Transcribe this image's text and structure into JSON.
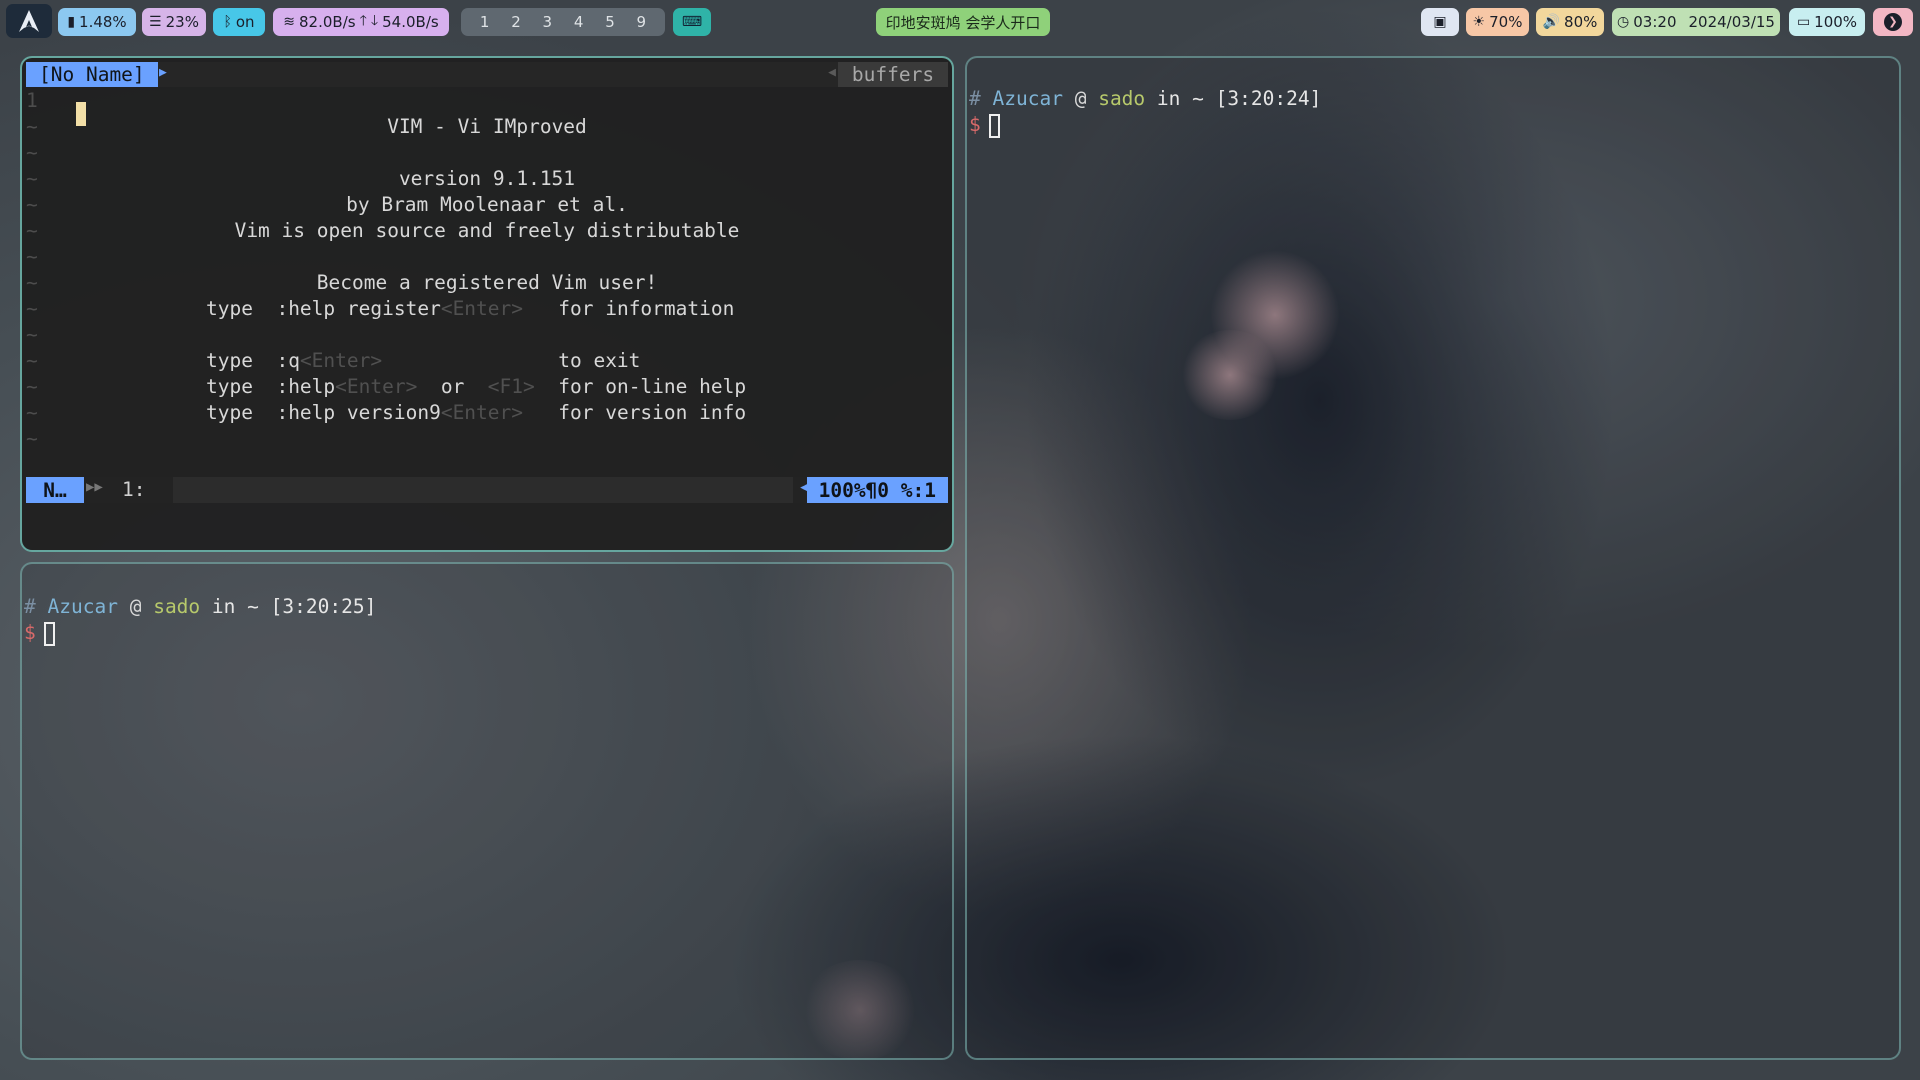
{
  "bar": {
    "cpu": "1.48%",
    "mem": "23%",
    "bluetooth": "on",
    "network": "82.0B/s",
    "network_down": "54.0B/s",
    "workspaces": [
      "1",
      "2",
      "3",
      "4",
      "5",
      "9"
    ],
    "window_title": "印地安斑鸠 会学人开口",
    "brightness": "70%",
    "volume": "80%",
    "clock": "03:20",
    "date": "2024/03/15",
    "battery": "100%",
    "colors": {
      "cpu": "#8cc8f0",
      "mem": "#d6b4e8",
      "bluetooth": "#47c7e8",
      "network": "#d7b0ee",
      "keyboard": "#2fb3a8",
      "title": "#8fd17a",
      "wallpaper": "#dfe6f2",
      "brightness": "#f7c7a6",
      "volume": "#f2d79c",
      "clock": "#bfe0b4",
      "battery": "#c8eef0",
      "power": "#f3b7c4"
    }
  },
  "vim": {
    "tab_name": "[No Name]",
    "buffers_label": "buffers",
    "gutter": [
      "1",
      "~",
      "~",
      "~",
      "~",
      "~",
      "~",
      "~",
      "~",
      "~",
      "~",
      "~",
      "~",
      "~"
    ],
    "title": "VIM - Vi IMproved",
    "version": "version 9.1.151",
    "author": "by Bram Moolenaar et al.",
    "license": "Vim is open source and freely distributable",
    "register_head": "Become a registered Vim user!",
    "lines": [
      {
        "t": "type  ",
        "cmd": ":help register",
        "key": "<Enter>",
        "gap": "   ",
        "desc": "for information"
      },
      {
        "t": "type  ",
        "cmd": ":q",
        "key": "<Enter>",
        "gap": "               ",
        "desc": "to exit"
      },
      {
        "t": "type  ",
        "cmd": ":help",
        "key": "<Enter>",
        "gap": "  or  ",
        "key2": "<F1>",
        "gap2": "  ",
        "desc": "for on-line help"
      },
      {
        "t": "type  ",
        "cmd": ":help version9",
        "key": "<Enter>",
        "gap": "   ",
        "desc": "for version info"
      }
    ],
    "mode": "N…",
    "bufnr": "1:",
    "position": "100%¶0  %:1"
  },
  "term_bottom_left": {
    "hash": "#",
    "user": "Azucar",
    "at": "@",
    "host": "sado",
    "in": "in",
    "path": "~",
    "time": "[3:20:25]",
    "dollar": "$"
  },
  "term_right": {
    "hash": "#",
    "user": "Azucar",
    "at": "@",
    "host": "sado",
    "in": "in",
    "path": "~",
    "time": "[3:20:24]",
    "dollar": "$"
  }
}
